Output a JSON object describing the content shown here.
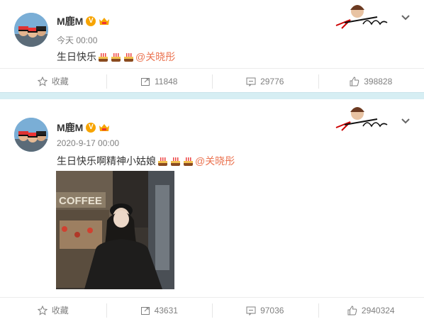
{
  "posts": [
    {
      "username": "M鹿M",
      "timestamp": "今天 00:00",
      "text": "生日快乐",
      "mention": "@关晓彤",
      "actions": {
        "favorite_label": "收藏",
        "repost_count": "11848",
        "comment_count": "29776",
        "like_count": "398828"
      }
    },
    {
      "username": "M鹿M",
      "timestamp": "2020-9-17 00:00",
      "text": "生日快乐啊精神小姑娘",
      "mention": "@关晓彤",
      "actions": {
        "favorite_label": "收藏",
        "repost_count": "43631",
        "comment_count": "97036",
        "like_count": "2940324"
      }
    }
  ],
  "icons": {
    "verified": "V",
    "favorite": "star-icon",
    "repost": "repost-icon",
    "comment": "comment-icon",
    "like": "thumbs-up-icon",
    "more": "chevron-down-icon",
    "cake": "birthday-cake-emoji"
  },
  "colors": {
    "mention": "#eb7350",
    "verified_badge": "#f7a400",
    "divider_band": "#d6eef3",
    "meta_text": "#808080"
  }
}
